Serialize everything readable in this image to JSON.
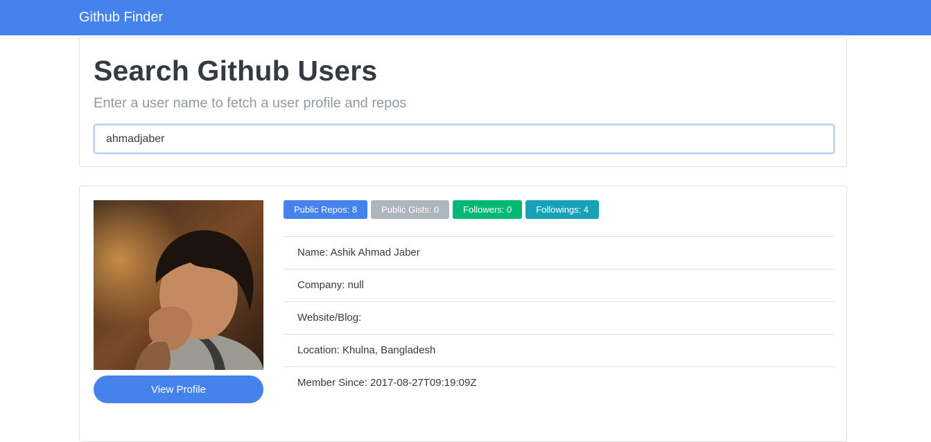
{
  "navbar": {
    "brand": "Github Finder"
  },
  "search": {
    "title": "Search Github Users",
    "subtitle": "Enter a user name to fetch a user profile and repos",
    "input_value": "ahmadjaber"
  },
  "profile": {
    "view_profile_label": "View Profile",
    "badges": {
      "repos": "Public Repos: 8",
      "gists": "Public Gists: 0",
      "followers": "Followers: 0",
      "followings": "Followings: 4"
    },
    "info": {
      "name": "Name: Ashik Ahmad Jaber",
      "company": "Company: null",
      "website": "Website/Blog:",
      "location": "Location: Khulna, Bangladesh",
      "member_since": "Member Since: 2017-08-27T09:19:09Z"
    }
  },
  "colors": {
    "primary": "#4582ec",
    "secondary": "#adb5bd",
    "success": "#02b875",
    "info": "#17a2b8"
  }
}
